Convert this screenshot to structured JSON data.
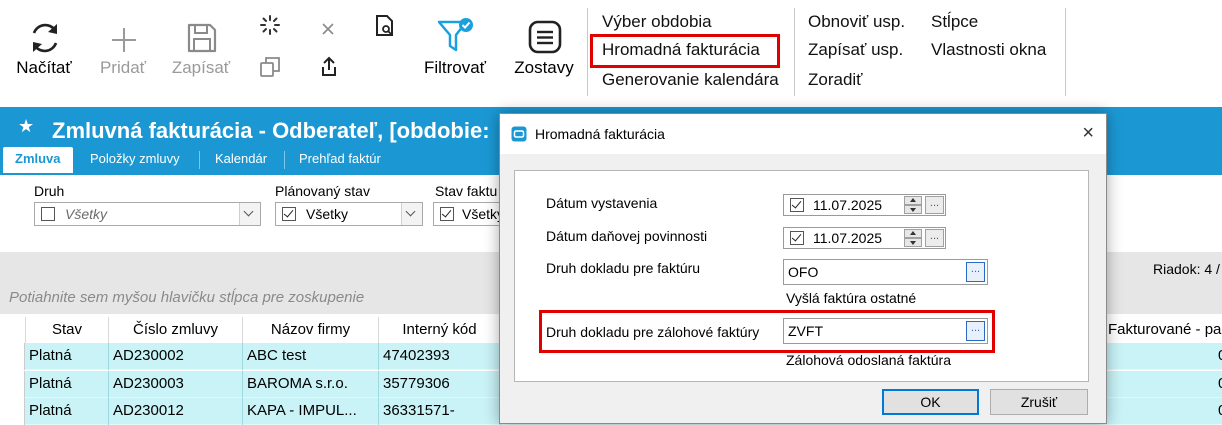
{
  "toolbar": {
    "load": "Načítať",
    "add": "Pridať",
    "save": "Zapísať",
    "filter": "Filtrovať",
    "reports": "Zostavy"
  },
  "menu": {
    "col1": [
      "Výber obdobia",
      "Hromadná fakturácia",
      "Generovanie kalendára"
    ],
    "col2": [
      "Obnoviť usp.",
      "Zapísať usp.",
      "Zoradiť"
    ],
    "col3": [
      "Stĺpce",
      "Vlastnosti okna"
    ]
  },
  "header": {
    "title": "Zmluvná fakturácia - Odberateľ, [obdobie:",
    "tabs": [
      "Zmluva",
      "Položky zmluvy",
      "Kalendár",
      "Prehľad faktúr"
    ]
  },
  "filters": {
    "druh_label": "Druh",
    "druh_value": "Všetky",
    "planovany_label": "Plánovaný stav",
    "planovany_value": "Všetky",
    "stav_label": "Stav faktu",
    "stav_value": "Všetky"
  },
  "grid": {
    "group_hint": "Potiahnite sem myšou hlavičku stĺpca pre zoskupenie",
    "row_info": "Riadok: 4 /",
    "columns": [
      "Stav",
      "Číslo zmluvy",
      "Názov firmy",
      "Interný kód",
      "Fakturované - pa"
    ],
    "rows": [
      {
        "stav": "Platná",
        "cislo": "AD230002",
        "nazov": "ABC test",
        "kod": "47402393",
        "fakt": "0"
      },
      {
        "stav": "Platná",
        "cislo": "AD230003",
        "nazov": "BAROMA s.r.o.",
        "kod": "35779306",
        "fakt": "0"
      },
      {
        "stav": "Platná",
        "cislo": "AD230012",
        "nazov": "KAPA - IMPUL...",
        "kod": "36331571-",
        "fakt": "0"
      }
    ]
  },
  "dialog": {
    "title": "Hromadná fakturácia",
    "close": "×",
    "datum_vystavenia_label": "Dátum vystavenia",
    "datum_vystavenia_value": "11.07.2025",
    "datum_dph_label": "Dátum daňovej povinnosti",
    "datum_dph_value": "11.07.2025",
    "druh_dokladu_label": "Druh dokladu pre faktúru",
    "druh_dokladu_value": "OFO",
    "druh_dokladu_desc": "Vyšlá faktúra ostatné",
    "druh_zalohove_label": "Druh dokladu pre zálohové faktúry",
    "druh_zalohove_value": "ZVFT",
    "druh_zalohove_desc": "Zálohová odoslaná faktúra",
    "ok": "OK",
    "cancel": "Zrušiť",
    "ellipsis": "..."
  },
  "colors": {
    "header_blue": "#1b98d4",
    "row_highlight": "#c9f3f7",
    "annotation_red": "#e00000",
    "filter_icon": "#1aa0dc"
  },
  "icons": [
    "refresh-icon",
    "plus-icon",
    "save-icon",
    "spinner-icon",
    "copy-icon",
    "close-icon",
    "share-icon",
    "find-icon",
    "filter-icon",
    "reports-icon",
    "star-icon",
    "app-icon"
  ]
}
